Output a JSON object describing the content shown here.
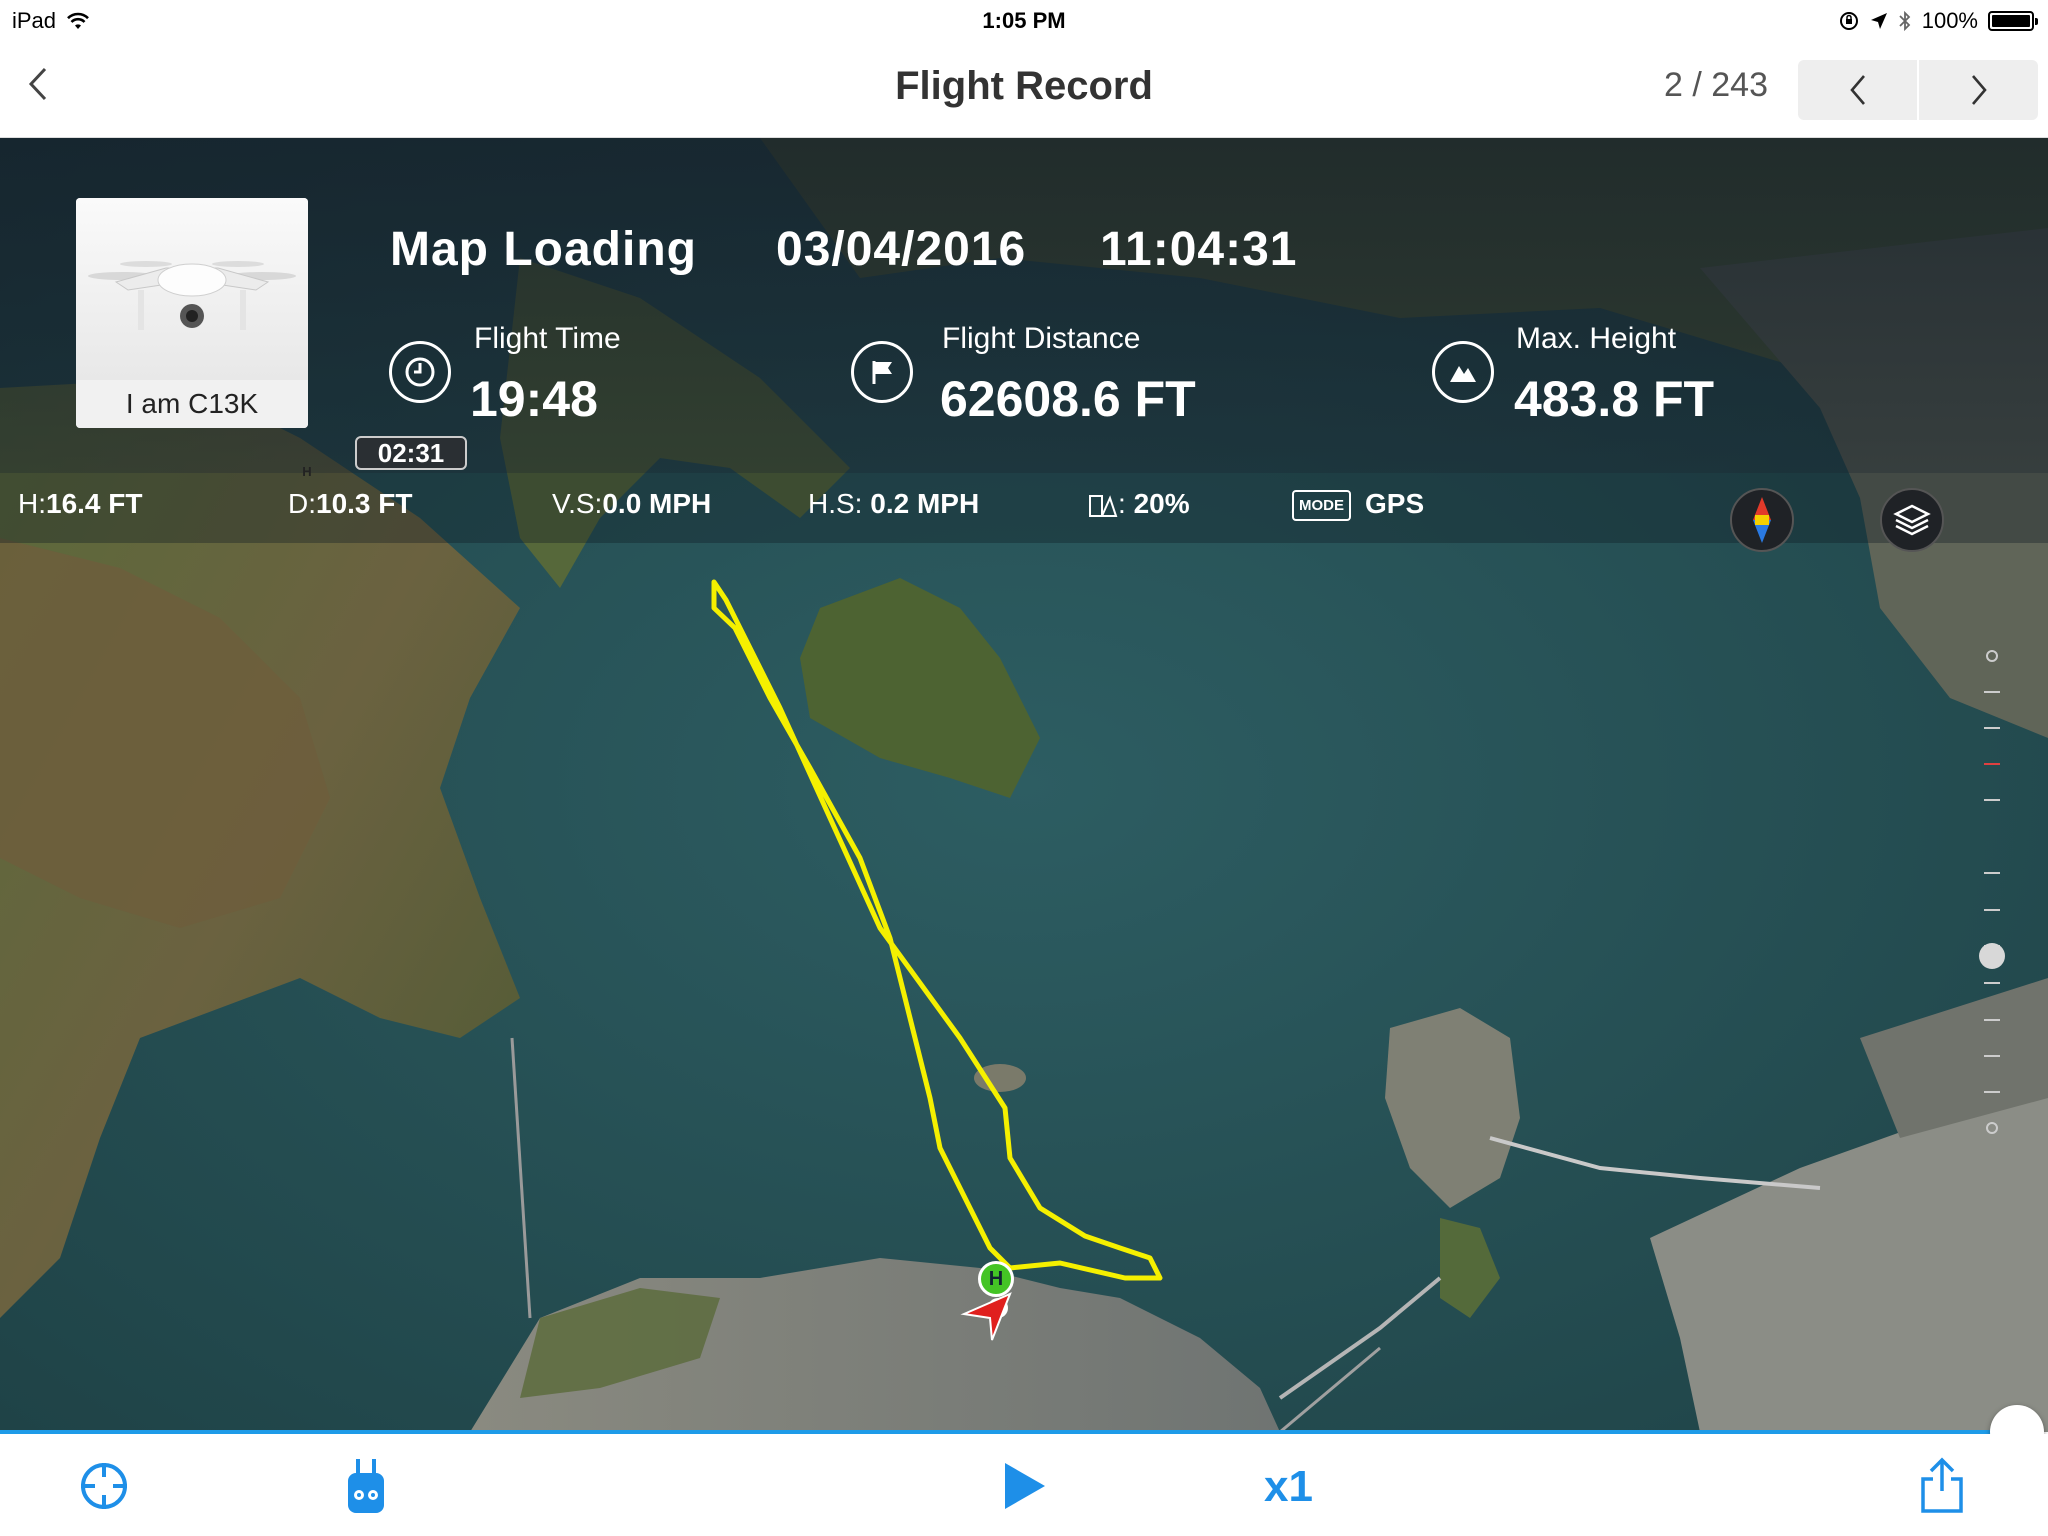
{
  "status_bar": {
    "device": "iPad",
    "time": "1:05 PM",
    "battery": "100%"
  },
  "nav": {
    "title": "Flight Record",
    "page_counter": "2 / 243"
  },
  "flight": {
    "aircraft_name": "I am C13K",
    "map_status": "Map Loading",
    "date": "03/04/2016",
    "time": "11:04:31",
    "flight_time_label": "Flight Time",
    "flight_time_value": "19:48",
    "flight_distance_label": "Flight Distance",
    "flight_distance_value": "62608.6 FT",
    "max_height_label": "Max. Height",
    "max_height_value": "483.8 FT"
  },
  "timeline": {
    "current_time": "02:31",
    "home_marker": "H"
  },
  "telemetry": {
    "h_label": "H:",
    "h_value": "16.4 FT",
    "d_label": "D:",
    "d_value": "10.3 FT",
    "vs_label": "V.S:",
    "vs_value": "0.0 MPH",
    "hs_label": "H.S:",
    "hs_value": "0.2 MPH",
    "battery_sep": ":",
    "battery_value": "20%",
    "mode_badge": "MODE",
    "mode_value": "GPS"
  },
  "playback": {
    "speed": "x1",
    "progress": 0.985
  },
  "colors": {
    "accent": "#1e8fe8",
    "track": "#f5f000",
    "home_marker": "#44c425",
    "aircraft_marker": "#e0201e",
    "water": "#254d52"
  }
}
